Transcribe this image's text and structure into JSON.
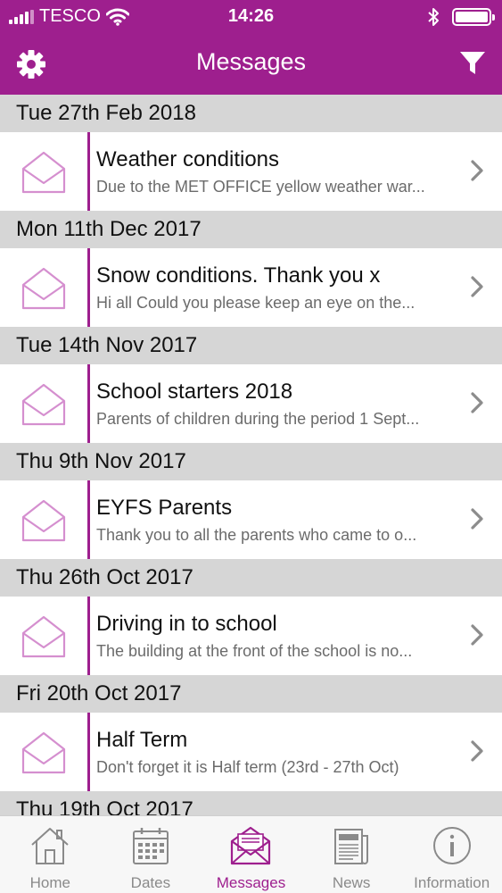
{
  "statusbar": {
    "carrier": "TESCO",
    "time": "14:26"
  },
  "navbar": {
    "title": "Messages"
  },
  "colors": {
    "brand": "#9e1f8e",
    "header_gray": "#d6d6d6",
    "preview_gray": "#6b6b6b"
  },
  "icons": {
    "settings": "gear-icon",
    "filter": "filter-icon",
    "message": "envelope-open-icon",
    "disclosure": "chevron-right-icon"
  },
  "sections": [
    {
      "date": "Tue 27th Feb 2018",
      "title": "Weather conditions",
      "preview": "Due to the MET OFFICE yellow weather war..."
    },
    {
      "date": "Mon 11th Dec 2017",
      "title": "Snow conditions. Thank you x",
      "preview": "Hi all Could you please keep an eye on the..."
    },
    {
      "date": "Tue 14th Nov 2017",
      "title": "School starters 2018",
      "preview": "Parents of children during the period 1 Sept..."
    },
    {
      "date": "Thu 9th Nov 2017",
      "title": "EYFS Parents",
      "preview": "Thank you to all the parents who came to o..."
    },
    {
      "date": "Thu 26th Oct 2017",
      "title": "Driving in to school",
      "preview": "The building at the front of the school is no..."
    },
    {
      "date": "Fri 20th Oct 2017",
      "title": "Half Term",
      "preview": "Don't forget it is Half term (23rd - 27th Oct)"
    },
    {
      "date": "Thu 19th Oct 2017"
    }
  ],
  "tabs": [
    {
      "label": "Home"
    },
    {
      "label": "Dates"
    },
    {
      "label": "Messages"
    },
    {
      "label": "News"
    },
    {
      "label": "Information"
    }
  ]
}
